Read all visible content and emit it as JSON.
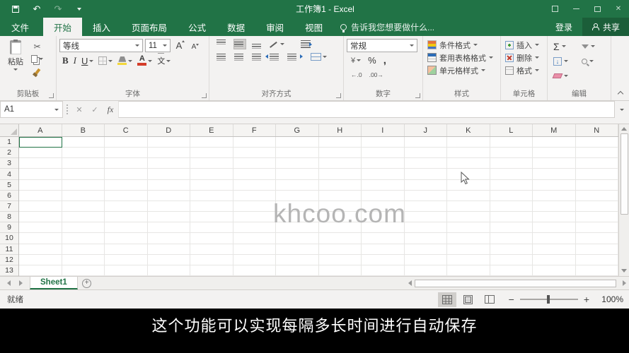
{
  "window": {
    "title": "工作簿1 - Excel"
  },
  "ribbon_tabs": {
    "file": "文件",
    "tabs": [
      "开始",
      "插入",
      "页面布局",
      "公式",
      "数据",
      "审阅",
      "视图"
    ],
    "active_tab": "开始",
    "tell_me": "告诉我您想要做什么...",
    "sign_in": "登录",
    "share": "共享"
  },
  "ribbon": {
    "clipboard": {
      "label": "剪贴板",
      "paste": "粘贴"
    },
    "font": {
      "label": "字体",
      "font_name": "等线",
      "font_size": "11"
    },
    "alignment": {
      "label": "对齐方式"
    },
    "number": {
      "label": "数字",
      "format": "常规"
    },
    "styles": {
      "label": "样式",
      "conditional_formatting": "条件格式",
      "format_as_table": "套用表格格式",
      "cell_styles": "单元格样式"
    },
    "cells": {
      "label": "单元格",
      "insert": "插入",
      "delete": "删除",
      "format": "格式"
    },
    "editing": {
      "label": "编辑"
    }
  },
  "formula_bar": {
    "name_box": "A1",
    "formula": ""
  },
  "grid": {
    "columns": [
      "A",
      "B",
      "C",
      "D",
      "E",
      "F",
      "G",
      "H",
      "I",
      "J",
      "K",
      "L",
      "M",
      "N"
    ],
    "rows": [
      "1",
      "2",
      "3",
      "4",
      "5",
      "6",
      "7",
      "8",
      "9",
      "10",
      "11",
      "12",
      "13"
    ],
    "selected_cell": "A1",
    "watermark": "khcoo.com"
  },
  "sheet_bar": {
    "sheet_tabs": [
      "Sheet1"
    ],
    "active_sheet": "Sheet1"
  },
  "status_bar": {
    "status": "就绪",
    "zoom_level": "100%"
  },
  "subtitle": "这个功能可以实现每隔多长时间进行自动保存",
  "icons": {
    "undo": "↶",
    "redo": "↷",
    "cancel": "✕",
    "enter": "✓",
    "fx": "fx",
    "scissors": "✂",
    "bold": "B",
    "italic": "I",
    "underline": "U",
    "phonetic": "文",
    "grow_font": "A",
    "shrink_font": "A",
    "autosum": "Σ",
    "percent": "%",
    "comma": ",",
    "accounting": "¥",
    "inc_decimal": "←.0",
    "dec_decimal": ".00→",
    "down_arrow": "↓",
    "add_sheet": "+",
    "zoom_out": "−",
    "zoom_in": "+",
    "minimize": "—",
    "close": "✕"
  },
  "colors": {
    "excel_green": "#217346",
    "subtitle_bg": "#000000",
    "watermark": "#B5B5B5",
    "active_tab_text": "#217346"
  }
}
